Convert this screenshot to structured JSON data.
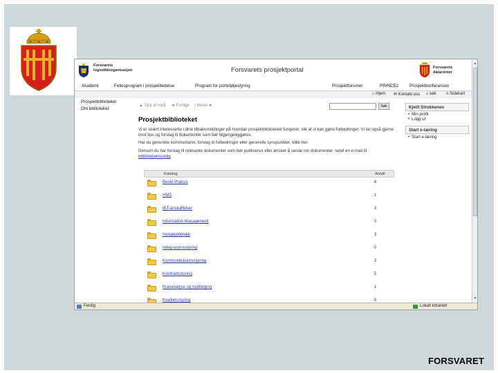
{
  "slide": {
    "footer_label": "FORSVARET"
  },
  "browser": {
    "header": {
      "org_line1": "Forsvarets",
      "org_line2": "logistikkorganisasjon",
      "portal_title": "Forsvarets prosjektportal",
      "right_org_line1": "Forsvarets",
      "right_org_line2": "datacenter"
    },
    "menu": [
      {
        "label": "Akademi"
      },
      {
        "label": "Fellesprogram i prosjektledelse"
      },
      {
        "label": "Program for porteføljestyring"
      },
      {
        "label": "Prosjektforumet"
      },
      {
        "label": "PRINCE2"
      },
      {
        "label": "Prosjektkonferansen"
      }
    ],
    "util_links": [
      {
        "label": "Hjem"
      },
      {
        "label": "Kontakt oss"
      },
      {
        "label": "søk"
      },
      {
        "label": "Sidekart"
      }
    ],
    "left_nav": [
      {
        "label": "Prosjektbiblioteket"
      },
      {
        "label": "Om biblioteket"
      }
    ],
    "breadcrumbs": [
      {
        "label": "Opp et nivå"
      },
      {
        "label": "Forrige"
      },
      {
        "label": "Neste"
      }
    ],
    "search": {
      "value": "",
      "button_label": "Søk"
    },
    "page_title": "Prosjektbiblioteket",
    "intro": {
      "p1": "Vi er svært interesserte i dine tilbakemeldinger på hvordan prosjektbiblioteket fungerer, slik at vi kan gjøre forbedringer. Vi tar også gjerne imot tips og forslag til dokumenter som bør tilgjengeliggjøres.",
      "p2": "Har du generelle kommentarer, forslag til forbedringer eller generelle synspunkter, klikk her.",
      "p3_pre": "Dersom du har forslag til relevante dokumenter som bør publiseres eller ønsker å sende inn dokumenter, send en e-mail til",
      "p3_link": "bibliotekansvarlig"
    },
    "catalog": {
      "col_catalog": "Katalog",
      "col_count": "Antall",
      "rows": [
        {
          "name": "Beste Praksis",
          "count": "6"
        },
        {
          "name": "HMS",
          "count": "1"
        },
        {
          "name": "IKT-anskaffelser",
          "count": "3"
        },
        {
          "name": "Information Management",
          "count": "0"
        },
        {
          "name": "Innkjøpsbolokk",
          "count": "3"
        },
        {
          "name": "Integrasjonsstyring",
          "count": "0"
        },
        {
          "name": "Kommunikasjonsstyring",
          "count": "3"
        },
        {
          "name": "Kostnadsstyring",
          "count": "5"
        },
        {
          "name": "Kravanalyse og oppfølging",
          "count": "1"
        },
        {
          "name": "Kvalitetsstyring",
          "count": "5"
        }
      ]
    },
    "right_panel": {
      "user_name": "Kjetil Strokkenes",
      "user_links": [
        {
          "label": "Min profil"
        },
        {
          "label": "Logg ut"
        }
      ],
      "elearning_title": "Start e-læring",
      "elearning_links": [
        {
          "label": "Start e-læring"
        }
      ]
    },
    "statusbar": {
      "status": "Ferdig",
      "zone": "Lokalt intranett"
    }
  }
}
